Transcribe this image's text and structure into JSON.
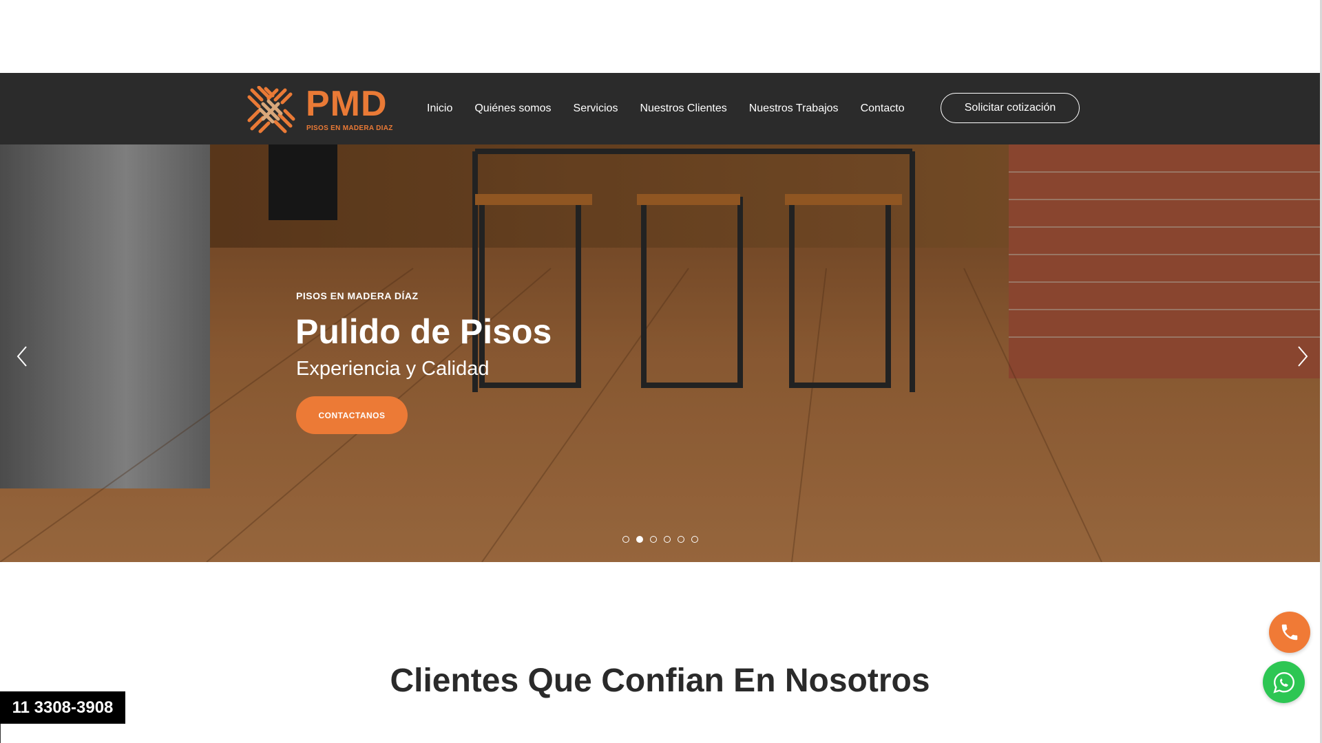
{
  "brand": {
    "name": "PMD",
    "tagline": "PISOS EN MADERA DIAZ",
    "accent_color": "#ea7a36"
  },
  "nav": {
    "items": [
      {
        "label": "Inicio"
      },
      {
        "label": "Quiénes somos"
      },
      {
        "label": "Servicios"
      },
      {
        "label": "Nuestros Clientes"
      },
      {
        "label": "Nuestros Trabajos"
      },
      {
        "label": "Contacto"
      }
    ],
    "quote_button": "Solicitar cotización"
  },
  "hero": {
    "kicker": "PISOS EN MADERA DÍAZ",
    "title": "Pulido de Pisos",
    "subtitle": "Experiencia y Calidad",
    "cta": "CONTACTANOS",
    "slide_count": 6,
    "active_slide": 2
  },
  "clients_section": {
    "title": "Clientes Que Confian En Nosotros"
  },
  "contact": {
    "phone": "11 3308-3908"
  },
  "floating": {
    "call_icon": "phone-icon",
    "whatsapp_icon": "whatsapp-icon"
  }
}
